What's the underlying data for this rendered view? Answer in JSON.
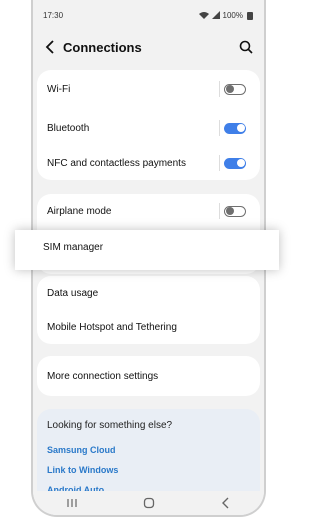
{
  "status": {
    "time": "17:30",
    "battery": "100%"
  },
  "header": {
    "title": "Connections"
  },
  "rows": {
    "wifi": "Wi-Fi",
    "bluetooth": "Bluetooth",
    "nfc": "NFC and contactless payments",
    "airplane": "Airplane mode",
    "sim": "SIM manager",
    "data_usage": "Data usage",
    "hotspot": "Mobile Hotspot and Tethering",
    "more": "More connection settings"
  },
  "toggles": {
    "wifi": "off",
    "bluetooth": "on",
    "nfc": "on",
    "airplane": "off"
  },
  "looking": {
    "title": "Looking for something else?",
    "links": [
      "Samsung Cloud",
      "Link to Windows",
      "Android Auto"
    ]
  },
  "colors": {
    "accent": "#3f7fe8",
    "link": "#2a79c9"
  }
}
